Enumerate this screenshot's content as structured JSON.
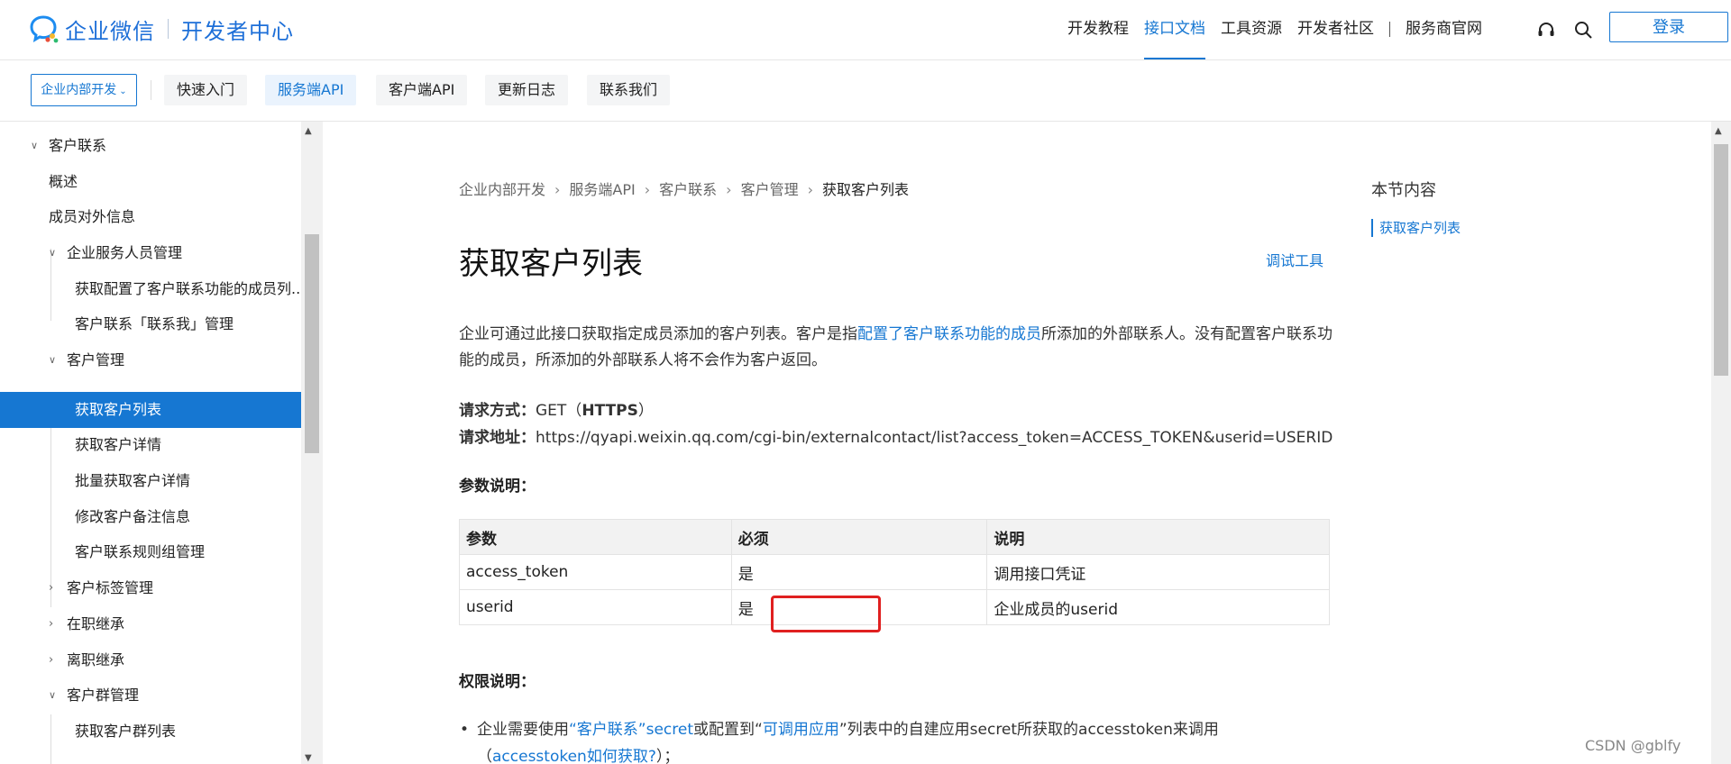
{
  "brand": {
    "name": "企业微信",
    "sub": "开发者中心"
  },
  "top_nav": [
    {
      "label": "开发教程",
      "active": false
    },
    {
      "label": "接口文档",
      "active": true
    },
    {
      "label": "工具资源",
      "active": false
    },
    {
      "label": "开发者社区",
      "active": false
    },
    {
      "label": "服务商官网",
      "active": false
    }
  ],
  "login_label": "登录",
  "sub_nav": {
    "dropdown": "企业内部开发",
    "tabs": [
      {
        "label": "快速入门",
        "active": false
      },
      {
        "label": "服务端API",
        "active": true
      },
      {
        "label": "客户端API",
        "active": false
      },
      {
        "label": "更新日志",
        "active": false
      },
      {
        "label": "联系我们",
        "active": false
      }
    ]
  },
  "sidebar": [
    {
      "label": "客户联系",
      "level": 0,
      "arrow": "down"
    },
    {
      "label": "概述",
      "level": 1
    },
    {
      "label": "成员对外信息",
      "level": 1
    },
    {
      "label": "企业服务人员管理",
      "level": 1,
      "arrow": "down"
    },
    {
      "label": "获取配置了客户联系功能的成员列...",
      "level": 2
    },
    {
      "label": "客户联系「联系我」管理",
      "level": 2
    },
    {
      "label": "客户管理",
      "level": 1,
      "arrow": "down"
    },
    {
      "label": "获取客户列表",
      "level": 2,
      "active": true
    },
    {
      "label": "获取客户详情",
      "level": 2
    },
    {
      "label": "批量获取客户详情",
      "level": 2
    },
    {
      "label": "修改客户备注信息",
      "level": 2
    },
    {
      "label": "客户联系规则组管理",
      "level": 2
    },
    {
      "label": "客户标签管理",
      "level": 1,
      "arrow": "right"
    },
    {
      "label": "在职继承",
      "level": 1,
      "arrow": "right"
    },
    {
      "label": "离职继承",
      "level": 1,
      "arrow": "right"
    },
    {
      "label": "客户群管理",
      "level": 1,
      "arrow": "down"
    },
    {
      "label": "获取客户群列表",
      "level": 2
    }
  ],
  "breadcrumb": [
    "企业内部开发",
    "服务端API",
    "客户联系",
    "客户管理",
    "获取客户列表"
  ],
  "page_title": "获取客户列表",
  "debug_tool": "调试工具",
  "intro": {
    "pre": "企业可通过此接口获取指定成员添加的客户列表。客户是指",
    "link": "配置了客户联系功能的成员",
    "post": "所添加的外部联系人。没有配置客户联系功能的成员，所添加的外部联系人将不会作为客户返回。"
  },
  "request": {
    "method_label": "请求方式：",
    "method": "GET（",
    "protocol": "HTTPS",
    "method_close": "）",
    "url_label": "请求地址：",
    "url": "https://qyapi.weixin.qq.com/cgi-bin/externalcontact/list?access_token=ACCESS_TOKEN&userid=USERID"
  },
  "params_heading": "参数说明：",
  "params_table": {
    "headers": [
      "参数",
      "必须",
      "说明"
    ],
    "rows": [
      [
        "access_token",
        "是",
        "调用接口凭证"
      ],
      [
        "userid",
        "是",
        "企业成员的userid"
      ]
    ]
  },
  "permission_heading": "权限说明：",
  "permission": {
    "t1": "企业需要使用",
    "l1": "“客户联系”secret",
    "t2": "或配置到“",
    "l2": "可调用应用",
    "t3": "”列表中的自建应用secret所获取的accesstoken来调用",
    "t4": "（",
    "l3": "accesstoken如何获取?",
    "t5": "）；"
  },
  "toc": {
    "title": "本节内容",
    "items": [
      "获取客户列表"
    ]
  },
  "watermark": "CSDN @gblfy",
  "colors": {
    "accent": "#1677d2",
    "highlight_box": "#e02020"
  }
}
